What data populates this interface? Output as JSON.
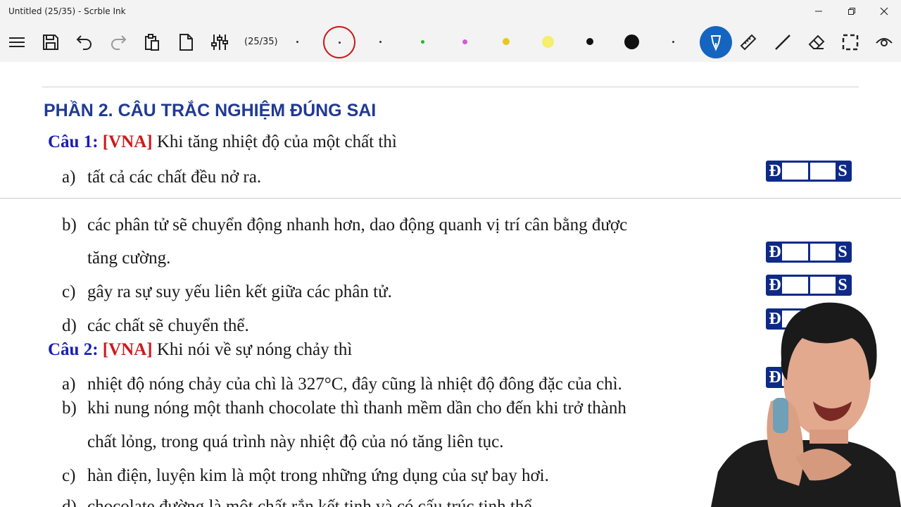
{
  "window": {
    "title": "Untitled (25/35) - Scrble Ink"
  },
  "toolbar": {
    "page_counter": "(25/35)",
    "icons": [
      "menu-icon",
      "save-icon",
      "undo-icon",
      "redo-icon",
      "paste-icon",
      "new-page-icon",
      "settings-sliders-icon",
      "pen-icon",
      "ruler-icon",
      "line-icon",
      "eraser-icon",
      "selection-icon",
      "view-icon"
    ],
    "colors": [
      "#333333",
      "#cc1a1a",
      "#333333",
      "#28b428",
      "#d65ad6",
      "#e6c81e",
      "#f5ee6e",
      "#111111",
      "#111111",
      "#333333"
    ],
    "active_tool_color": "#1565c0"
  },
  "document": {
    "section_title": "PHẦN 2. CÂU TRẮC NGHIỆM ĐÚNG SAI",
    "q1": {
      "label": "Câu 1:",
      "tag": "[VNA]",
      "stem": "Khi tăng nhiệt độ của một chất thì",
      "a_letter": "a)",
      "a_text": "tất cả các chất đều nở ra.",
      "b_letter": "b)",
      "b_text": "các phân tử sẽ chuyển động nhanh hơn, dao động quanh vị trí cân bằng được",
      "b_text2": "tăng cường.",
      "c_letter": "c)",
      "c_text": "gây ra sự suy yếu liên kết giữa các phân tử.",
      "d_letter": "d)",
      "d_text": "các chất sẽ chuyển thể."
    },
    "q2": {
      "label": "Câu 2:",
      "tag": "[VNA]",
      "stem": "Khi nói về sự nóng chảy thì",
      "a_letter": "a)",
      "a_text": "nhiệt độ nóng chảy của chì là 327°C, đây cũng là nhiệt độ đông đặc của chì.",
      "b_letter": "b)",
      "b_text": "khi nung nóng một thanh chocolate thì thanh mềm dần cho đến khi trở thành",
      "b_text2": "chất lỏng, trong quá trình này nhiệt độ của nó tăng liên tục.",
      "c_letter": "c)",
      "c_text": "hàn điện, luyện kim là một trong những ứng dụng của sự bay hơi.",
      "d_letter": "d)",
      "d_text": "chocolate đường là một chất rắn kết tinh và có cấu trúc tinh thể."
    },
    "answer_box": {
      "true_label": "Đ",
      "false_label": "S"
    }
  }
}
